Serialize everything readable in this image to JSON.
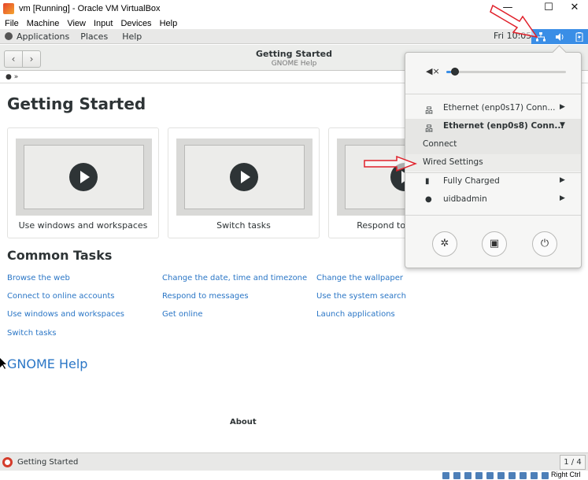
{
  "vbox": {
    "title": "vm [Running] - Oracle VM VirtualBox",
    "menu": [
      "File",
      "Machine",
      "View",
      "Input",
      "Devices",
      "Help"
    ],
    "minimize": "—",
    "maximize": "☐",
    "close": "✕",
    "host_key": "Right Ctrl"
  },
  "topbar": {
    "applications": "Applications",
    "places": "Places",
    "help": "Help",
    "clock": "Fri 10:05"
  },
  "help_window": {
    "title": "Getting Started",
    "subtitle": "GNOME Help",
    "breadcrumb": "»"
  },
  "page": {
    "title": "Getting Started",
    "videos": [
      {
        "caption": "Use windows and workspaces"
      },
      {
        "caption": "Switch tasks"
      },
      {
        "caption": "Respond to messages"
      }
    ],
    "common_tasks_title": "Common Tasks",
    "tasks": [
      [
        "Browse the web",
        "Change the date, time and timezone",
        "Change the wallpaper"
      ],
      [
        "Connect to online accounts",
        "Respond to messages",
        "Use the system search"
      ],
      [
        "Use windows and workspaces",
        "Get online",
        "Launch applications"
      ],
      [
        "Switch tasks"
      ]
    ],
    "gnome_help": "GNOME Help",
    "about": "About"
  },
  "system_menu": {
    "volume_level": 0.04,
    "items": {
      "ethernet1": "Ethernet (enp0s17) Conn...",
      "ethernet2": "Ethernet (enp0s8) Conn...",
      "connect": "Connect",
      "wired_settings": "Wired Settings",
      "battery": "Fully Charged",
      "user": "uidbadmin"
    },
    "accent_color": "#3a8ee6"
  },
  "taskbar": {
    "window_label": "Getting Started",
    "pager": "1 / 4"
  }
}
